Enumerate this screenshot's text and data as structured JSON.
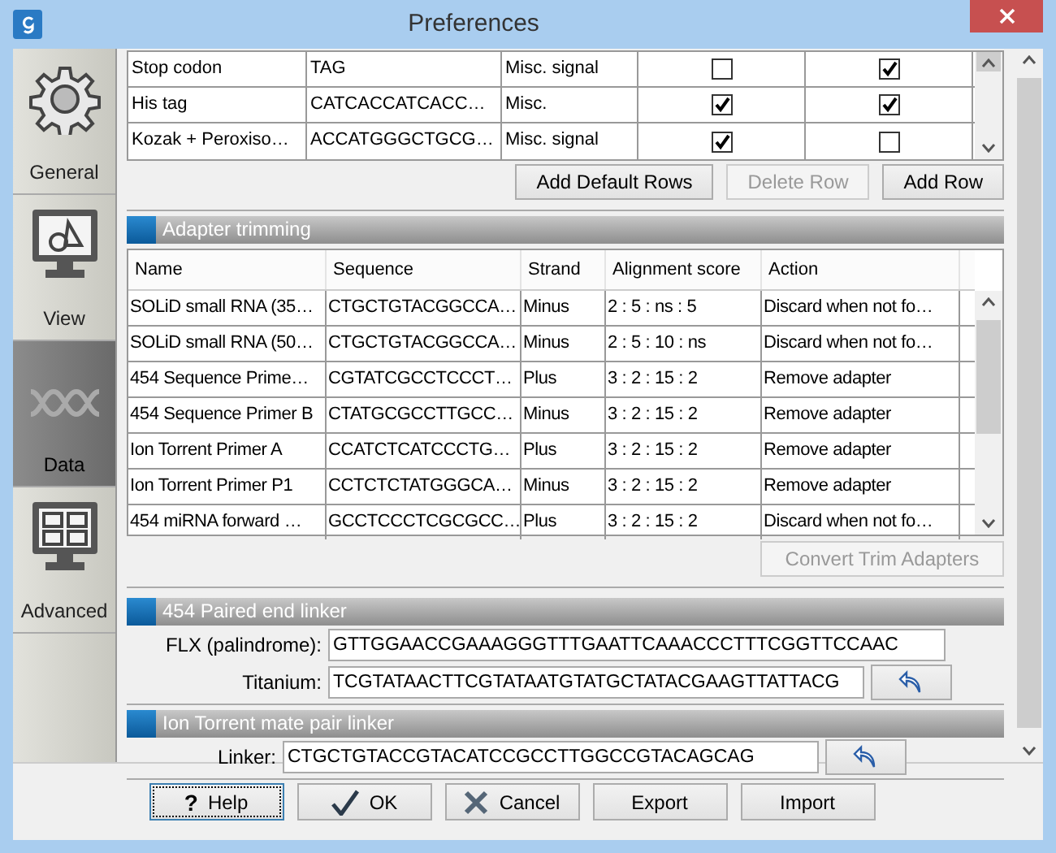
{
  "window": {
    "title": "Preferences"
  },
  "sidebar": {
    "items": [
      {
        "label": "General",
        "selected": false
      },
      {
        "label": "View",
        "selected": false
      },
      {
        "label": "Data",
        "selected": true
      },
      {
        "label": "Advanced",
        "selected": false
      }
    ]
  },
  "feature_table": {
    "rows": [
      {
        "cells": [
          "Stop codon",
          "TAG",
          "Misc. signal"
        ],
        "checks": [
          {
            "checked": false
          },
          {
            "checked": true
          }
        ]
      },
      {
        "cells": [
          "His tag",
          "CATCACCATCACC…",
          "Misc."
        ],
        "checks": [
          {
            "checked": true
          },
          {
            "checked": true
          }
        ]
      },
      {
        "cells": [
          "Kozak + Peroxiso…",
          "ACCATGGGCTGCG…",
          "Misc. signal"
        ],
        "checks": [
          {
            "checked": true
          },
          {
            "checked": false
          }
        ]
      }
    ],
    "buttons": [
      {
        "label": "Add Default Rows",
        "disabled": false
      },
      {
        "label": "Delete Row",
        "disabled": true
      },
      {
        "label": "Add Row",
        "disabled": false
      }
    ]
  },
  "adapter_trimming": {
    "title": "Adapter trimming",
    "columns": [
      "Name",
      "Sequence",
      "Strand",
      "Alignment score",
      "Action"
    ],
    "rows": [
      [
        "SOLiD small RNA (35…",
        "CTGCTGTACGGCCA…",
        "Minus",
        "2 : 5 : ns : 5",
        "Discard when not fo…"
      ],
      [
        "SOLiD small RNA (50…",
        "CTGCTGTACGGCCA…",
        "Minus",
        "2 : 5 : 10 : ns",
        "Discard when not fo…"
      ],
      [
        "454 Sequence Prime…",
        "CGTATCGCCTCCCT…",
        "Plus",
        "3 : 2 : 15 : 2",
        "Remove adapter"
      ],
      [
        "454 Sequence Primer B",
        "CTATGCGCCTTGCC…",
        "Minus",
        "3 : 2 : 15 : 2",
        "Remove adapter"
      ],
      [
        "Ion Torrent Primer A",
        "CCATCTCATCCCTG…",
        "Plus",
        "3 : 2 : 15 : 2",
        "Remove adapter"
      ],
      [
        "Ion Torrent Primer P1",
        "CCTCTCTATGGGCA…",
        "Minus",
        "3 : 2 : 15 : 2",
        "Remove adapter"
      ],
      [
        "454 miRNA forward …",
        "GCCTCCCTCGCGCC…",
        "Plus",
        "3 : 2 : 15 : 2",
        "Discard when not fo…"
      ]
    ],
    "button": {
      "label": "Convert Trim Adapters",
      "disabled": true
    }
  },
  "sections": [
    {
      "title": "454 Paired end linker",
      "fields": [
        {
          "label": "FLX (palindrome):",
          "value": "GTTGGAACCGAAAGGGTTTGAATTCAAACCCTTTCGGTTCCAAC",
          "reset_button": false
        },
        {
          "label": "Titanium:",
          "value": "TCGTATAACTTCGTATAATGTATGCTATACGAAGTTATTACG",
          "reset_button": true
        }
      ]
    },
    {
      "title": "Ion Torrent mate pair linker",
      "fields": [
        {
          "label": "Linker:",
          "value": "CTGCTGTACCGTACATCCGCCTTGGCCGTACAGCAG",
          "reset_button": true
        }
      ]
    }
  ],
  "buttons": [
    {
      "label": "Help",
      "kind": "help",
      "glyph": "?",
      "focused": true
    },
    {
      "label": "OK",
      "kind": "ok",
      "focused": false
    },
    {
      "label": "Cancel",
      "kind": "cancel",
      "focused": false
    },
    {
      "label": "Export",
      "kind": "plain",
      "focused": false
    },
    {
      "label": "Import",
      "kind": "plain",
      "focused": false
    }
  ]
}
